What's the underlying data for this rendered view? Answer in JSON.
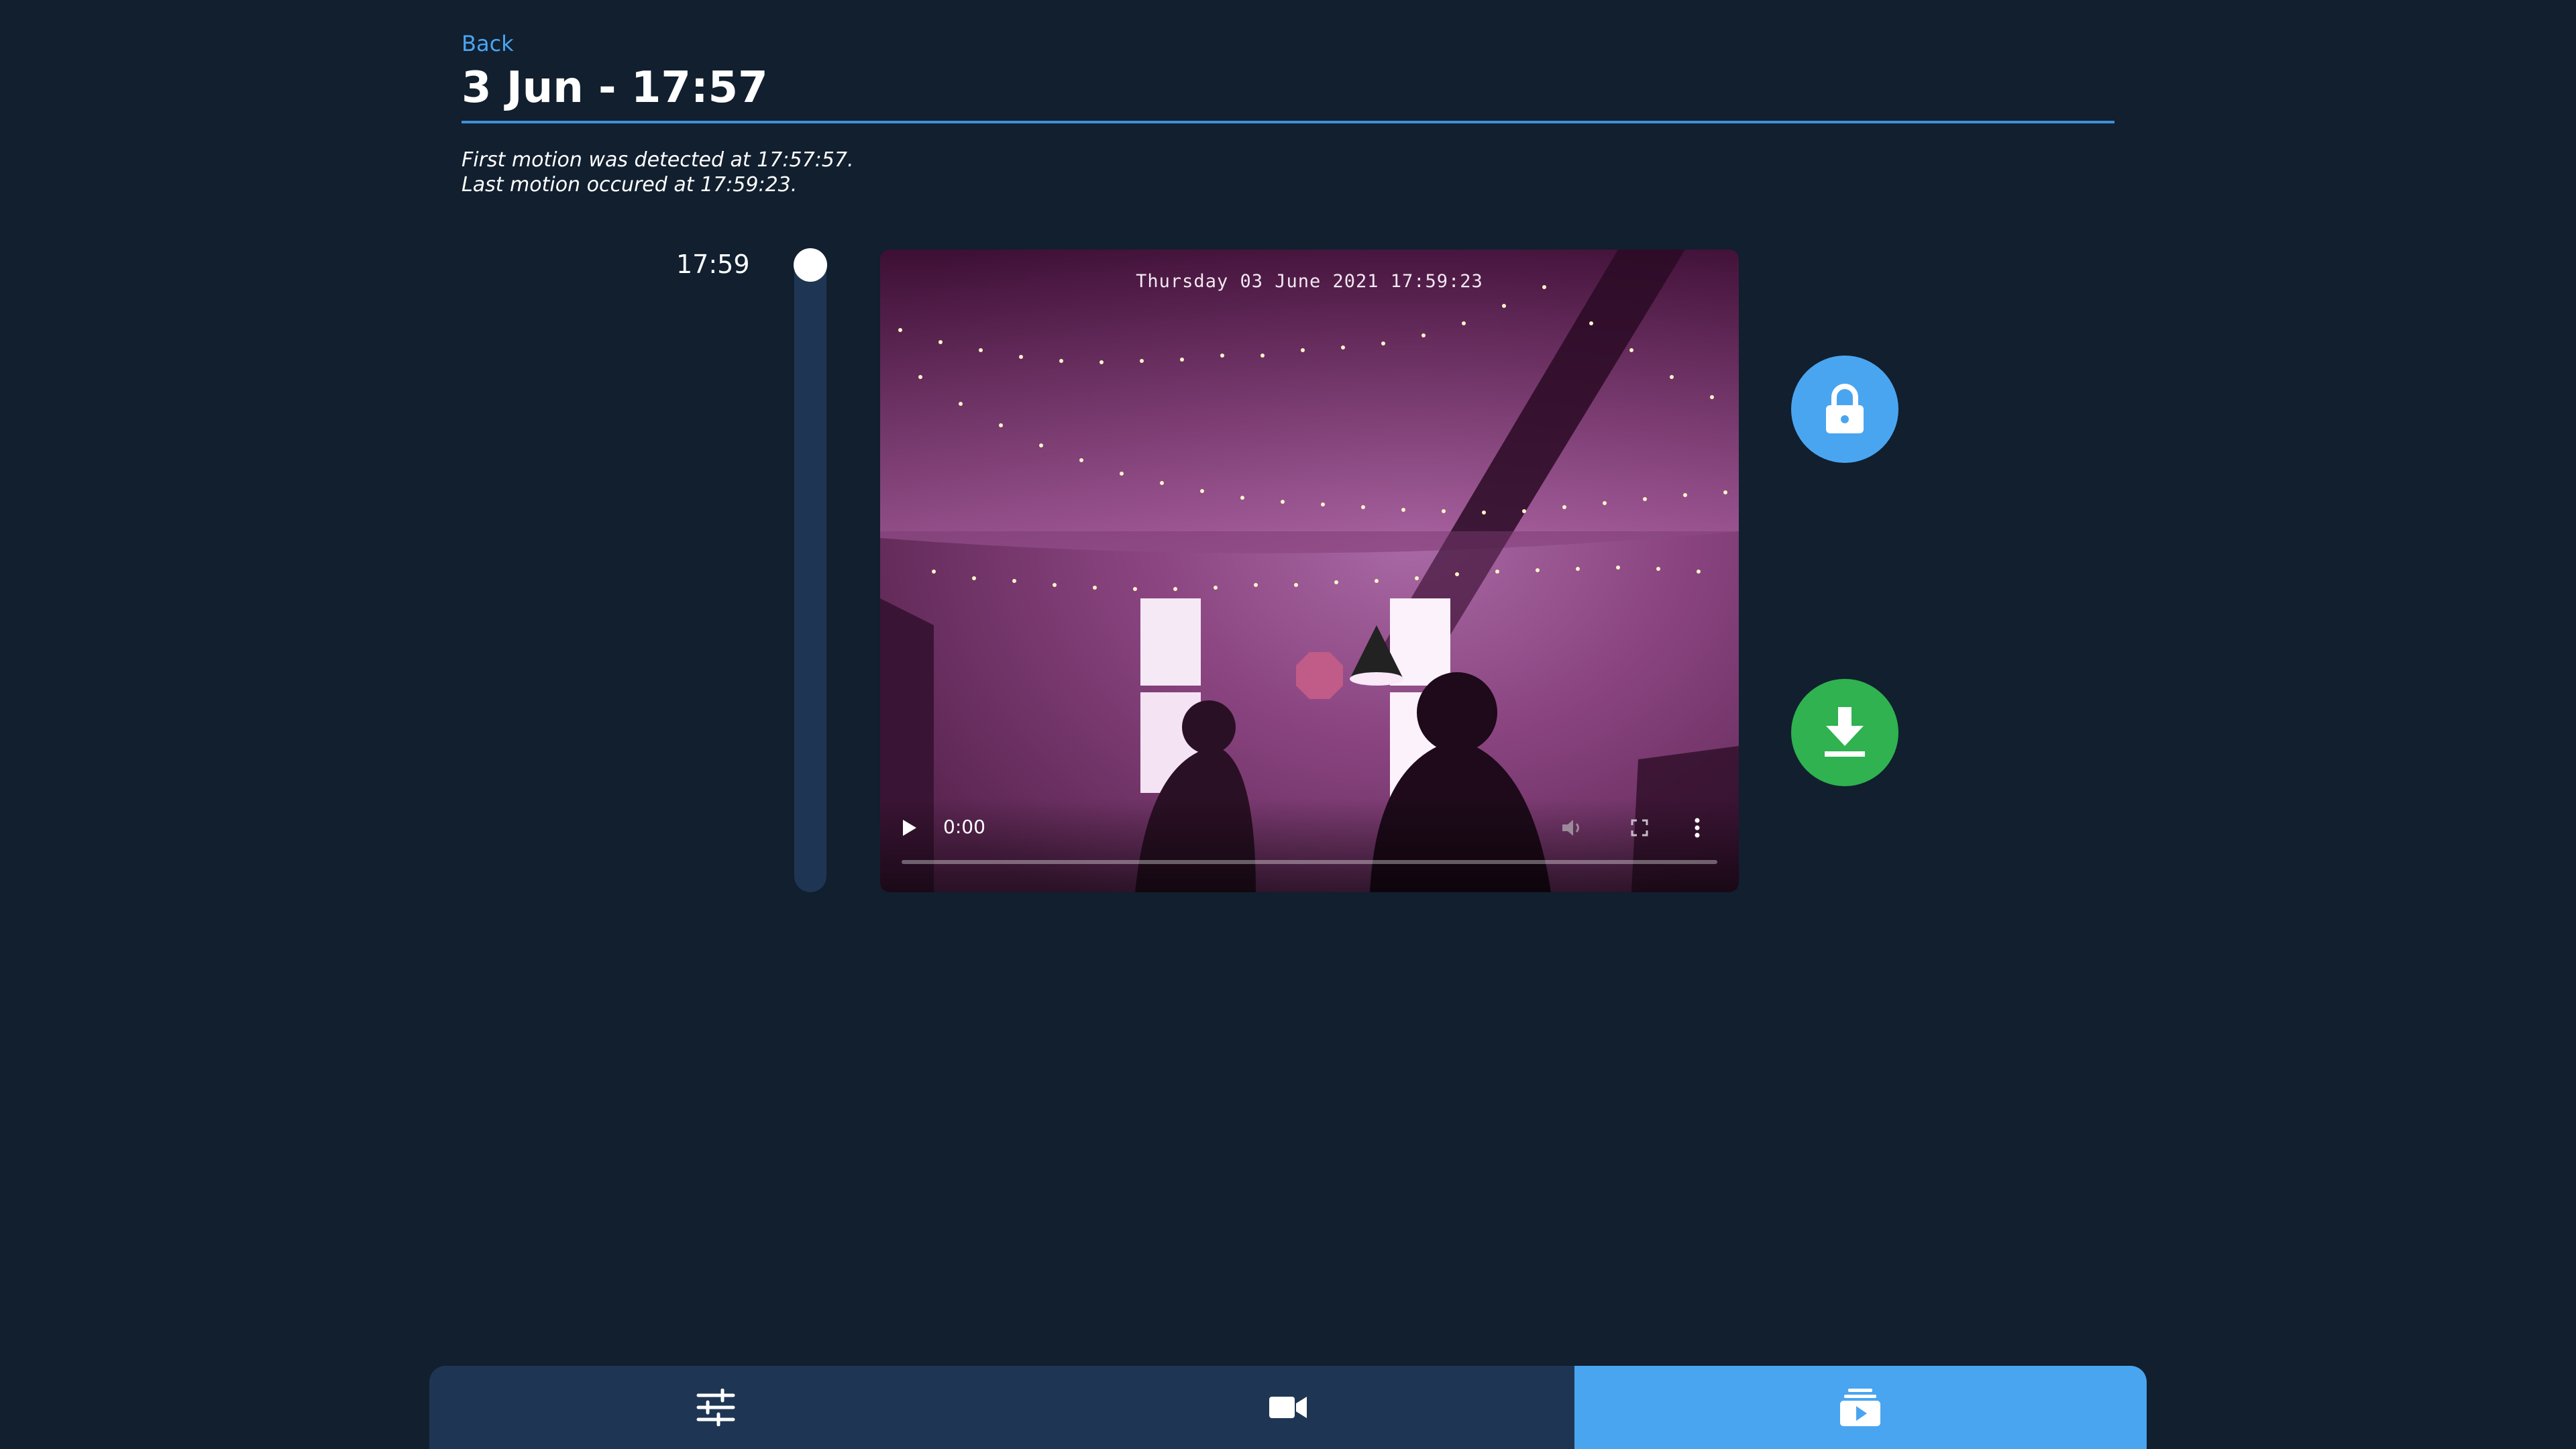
{
  "header": {
    "back_label": "Back",
    "title": "3 Jun - 17:57"
  },
  "motion": {
    "first": "First motion was detected at 17:57:57.",
    "last": "Last motion occured at 17:59:23."
  },
  "timeline": {
    "time_label": "17:59"
  },
  "video": {
    "osd_timestamp": "Thursday 03 June 2021 17:59:23",
    "current_time": "0:00",
    "progress_fraction": 0
  },
  "actions": [
    {
      "name": "lock",
      "icon": "lock-icon",
      "color": "#4aa5f0"
    },
    {
      "name": "download",
      "icon": "download-icon",
      "color": "#2fb24f"
    }
  ],
  "nav": {
    "tabs": [
      {
        "icon": "sliders-icon",
        "active": false
      },
      {
        "icon": "video-camera-icon",
        "active": false
      },
      {
        "icon": "recordings-icon",
        "active": true
      }
    ]
  },
  "colors": {
    "background": "#111f2f",
    "accent": "#4aa5f0",
    "success": "#2fb24f",
    "panel": "#1e3653"
  }
}
